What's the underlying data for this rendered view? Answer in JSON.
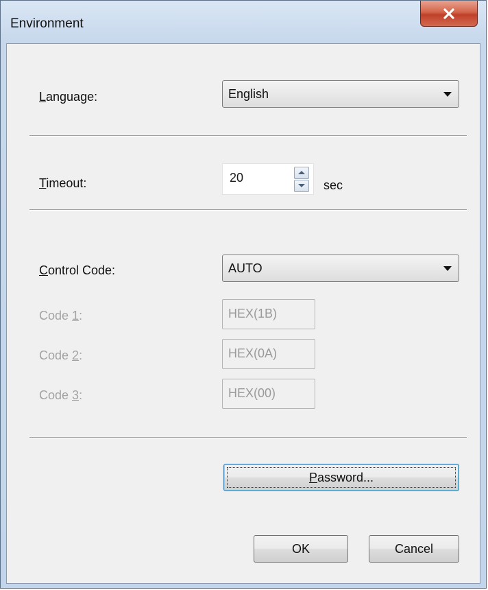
{
  "window": {
    "title": "Environment",
    "close_label": "x"
  },
  "language": {
    "label_u": "L",
    "label_rest": "anguage:",
    "value": "English"
  },
  "timeout": {
    "label_u": "T",
    "label_rest": "imeout:",
    "value": "20",
    "unit": "sec"
  },
  "control_code": {
    "label_u": "C",
    "label_rest": "ontrol Code:",
    "value": "AUTO"
  },
  "codes": [
    {
      "label_pre": "Code ",
      "label_u": "1",
      "label_post": ":",
      "value": "HEX(1B)"
    },
    {
      "label_pre": "Code ",
      "label_u": "2",
      "label_post": ":",
      "value": "HEX(0A)"
    },
    {
      "label_pre": "Code ",
      "label_u": "3",
      "label_post": ":",
      "value": "HEX(00)"
    }
  ],
  "buttons": {
    "password_u": "P",
    "password_rest": "assword...",
    "ok": "OK",
    "cancel": "Cancel"
  },
  "colors": {
    "close_red": "#c0412a",
    "frame_blue": "#c7d8ec",
    "client_gray": "#f0f0f0"
  }
}
